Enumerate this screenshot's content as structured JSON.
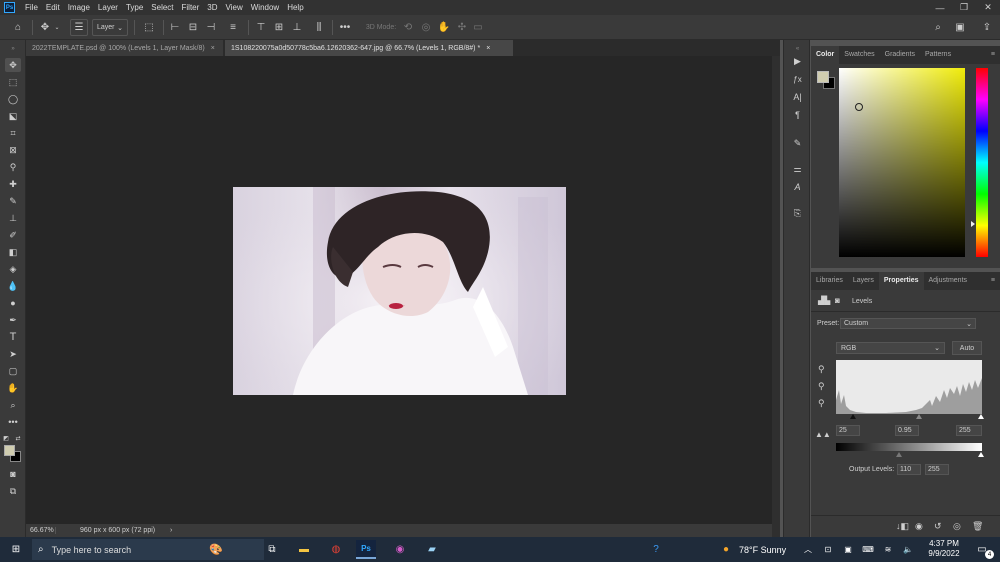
{
  "menubar": {
    "logo": "Ps",
    "items": [
      "File",
      "Edit",
      "Image",
      "Layer",
      "Type",
      "Select",
      "Filter",
      "3D",
      "View",
      "Window",
      "Help"
    ],
    "window_controls": [
      "minimize-icon",
      "restore-icon",
      "close-icon"
    ]
  },
  "options_bar": {
    "layer_dropdown": "Layer",
    "mode_3d": "3D Mode:"
  },
  "doc_tabs": [
    {
      "title": "2022TEMPLATE.psd @ 100% (Levels 1, Layer Mask/8)",
      "close": "×",
      "active": false
    },
    {
      "title": "1S108220075a0d50778c5ba6.12620362-647.jpg @ 66.7% (Levels 1, RGB/8#) *",
      "close": "×",
      "active": true
    }
  ],
  "status": {
    "zoom": "66.67%",
    "doc_size": "960 px x 600 px (72 ppi)",
    "arrow": "›"
  },
  "color_panel": {
    "tabs": [
      "Color",
      "Swatches",
      "Gradients",
      "Patterns"
    ],
    "active": "Color",
    "foreground": "#d0cdb0",
    "background": "#000000",
    "hue_base": "#f0ec0a"
  },
  "properties_panel": {
    "tabs": [
      "Libraries",
      "Layers",
      "Properties",
      "Adjustments"
    ],
    "active": "Properties",
    "adjustment_name": "Levels",
    "preset_label": "Preset:",
    "preset_value": "Custom",
    "channel": "RGB",
    "auto_label": "Auto",
    "input_black": "25",
    "input_gamma": "0.95",
    "input_white": "255",
    "output_label": "Output Levels:",
    "output_black": "110",
    "output_white": "255"
  },
  "taskbar": {
    "search_placeholder": "Type here to search",
    "weather": "78°F  Sunny",
    "time": "4:37 PM",
    "date": "9/9/2022",
    "notification_count": "4"
  }
}
